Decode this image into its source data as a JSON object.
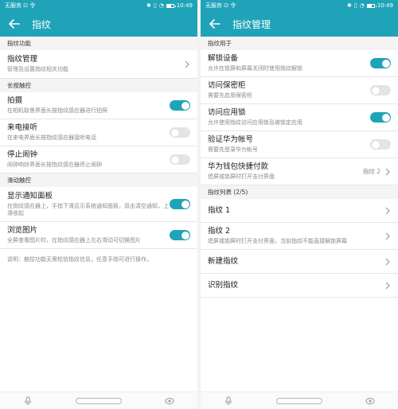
{
  "colors": {
    "accent": "#1fa3b8",
    "toggle_off": "#e4e4e4",
    "section_bg": "#f4f4f4"
  },
  "status_bar": {
    "carrier": "无服务 ⊡ 令",
    "time": "10:49",
    "battery_level": 0.6
  },
  "left": {
    "title": "指纹",
    "sections": [
      {
        "header": "指纹功能"
      },
      {
        "header": "长按触控"
      },
      {
        "header": "滑动触控"
      }
    ],
    "rows": {
      "fp_manage": {
        "title": "指纹管理",
        "subtitle": "管理及设置指纹相关功能"
      },
      "photo": {
        "title": "拍摄",
        "subtitle": "在相机取景界面长按指纹感应器进行拍照",
        "on": true
      },
      "answer_call": {
        "title": "来电接听",
        "subtitle": "在来电界面长按指纹感应器接听电话",
        "on": false
      },
      "stop_alarm": {
        "title": "停止闹钟",
        "subtitle": "闹钟响铃界面长按指纹感应器停止闹钟",
        "on": false
      },
      "notif_panel": {
        "title": "显示通知面板",
        "subtitle": "在指纹感应器上，手指下滑显示系统通知面板，双击清空通知，上滑收起",
        "on": true
      },
      "browse_pics": {
        "title": "浏览图片",
        "subtitle": "全屏查看图片时，在指纹感应器上左右滑动可切换图片",
        "on": true
      }
    },
    "note": "说明：触控功能无需校验指纹信息，任意手指可进行操作。"
  },
  "right": {
    "title": "指纹管理",
    "sections": [
      {
        "header": "指纹用于"
      },
      {
        "header": "指纹列表 (2/5)"
      }
    ],
    "rows": {
      "unlock": {
        "title": "解锁设备",
        "subtitle": "允许在锁屏和屏幕关闭时使用指纹解锁",
        "on": true
      },
      "safe": {
        "title": "访问保密柜",
        "subtitle": "需要先启用保密柜",
        "on": false
      },
      "app_lock": {
        "title": "访问应用锁",
        "subtitle": "允许使用指纹访问应用锁及被锁定应用",
        "on": true
      },
      "huawei_id": {
        "title": "验证华为帐号",
        "subtitle": "需要先登录华为帐号",
        "on": false
      },
      "wallet": {
        "title": "华为钱包快捷付款",
        "subtitle": "熄屏或锁屏时打开支付界面",
        "trailing": "指纹 2"
      },
      "fp1": {
        "title": "指纹 1"
      },
      "fp2": {
        "title": "指纹 2",
        "subtitle": "熄屏或锁屏时打开支付界面，当前指纹不能直接解锁屏幕"
      },
      "new_fp": {
        "title": "新建指纹"
      },
      "identify_fp": {
        "title": "识别指纹"
      }
    }
  },
  "icons": {
    "back": "arrow-left-icon",
    "chevron": "chevron-right-icon",
    "mic": "microphone-icon",
    "eye": "eye-icon"
  }
}
